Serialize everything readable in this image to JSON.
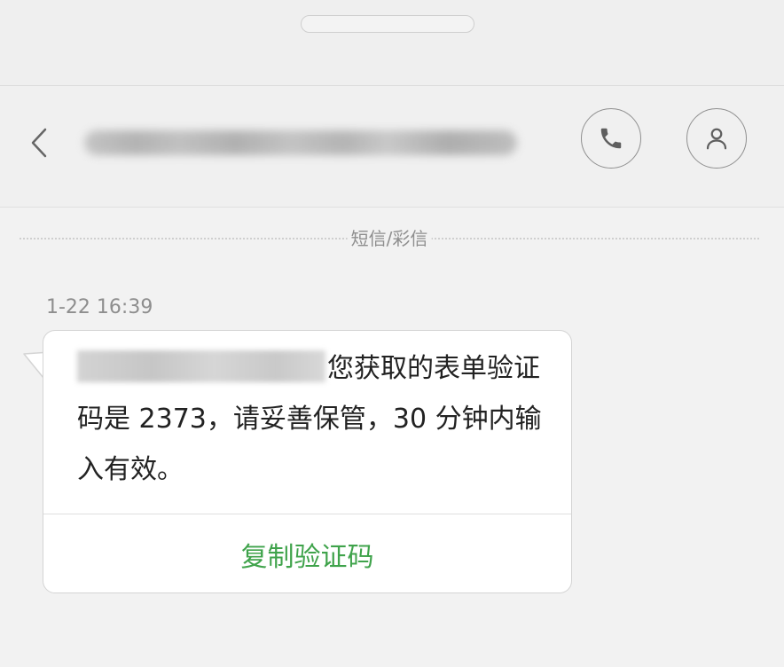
{
  "header": {
    "back_icon": "chevron-left-icon",
    "call_icon": "phone-icon",
    "contact_icon": "person-icon"
  },
  "conversation": {
    "divider_label": "短信/彩信",
    "timestamp": "1-22 16:39",
    "message": {
      "text": "您获取的表单验证码是 2373，请妥善保管，30 分钟内输入有效。",
      "action_label": "复制验证码"
    }
  },
  "colors": {
    "accent_green": "#3fa34b",
    "background": "#f2f2f2",
    "icon_gray": "#6f6f6f"
  }
}
